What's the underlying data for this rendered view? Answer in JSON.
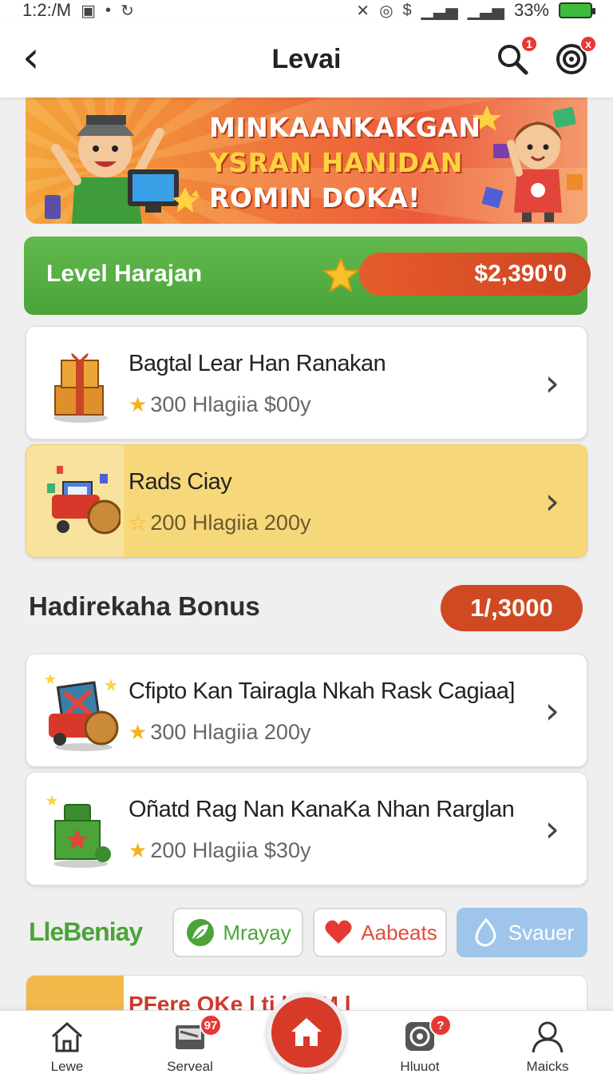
{
  "status_bar": {
    "time": "1:2:/M",
    "battery": "33%",
    "money_glyph": "$"
  },
  "header": {
    "title": "Levai",
    "search_badge": "1",
    "target_badge": "x"
  },
  "promo": {
    "lines": [
      "MINKAANKAKGAN",
      "YSRAN HANIDAN",
      "ROMIN DOKA!"
    ]
  },
  "level": {
    "label": "Level Harajan",
    "amount": "$2,390'0"
  },
  "cards": [
    {
      "title": "Bagtal Lear Han Ranakan",
      "meta": "300 Hlagiia $00y",
      "icon": "gift-box-icon"
    },
    {
      "title": "Rads Ciay",
      "meta": "200 Hlagiia 200y",
      "icon": "gift-cart-icon"
    },
    {
      "title": "Cfipto Kan Tairagla  Nkah Rask Cagiaa]",
      "meta": "300 Hlagiia 200y",
      "icon": "treasure-cart-icon"
    },
    {
      "title": "Oñatd Rag Nan KanaKa Nhan Rarglan",
      "meta": "200 Hlagiia $30y",
      "icon": "green-gift-icon"
    }
  ],
  "section": {
    "title": "Hadirekaha Bonus",
    "pill": "1/,3000"
  },
  "chips": {
    "title": "LleBeniay",
    "items": [
      {
        "label": "Mrayay",
        "icon": "leaf-icon",
        "color": "#4aa43a"
      },
      {
        "label": "Aabeats",
        "icon": "heart-icon",
        "color": "#e24c3c"
      },
      {
        "label": "Svauer",
        "icon": "drop-icon",
        "color": "#9fc6ea"
      }
    ]
  },
  "peek": {
    "text": "PFere OKe  l  ti     k  h    M     l"
  },
  "bottom_nav": {
    "items": [
      {
        "label": "Lewe",
        "icon": "home-outline-icon"
      },
      {
        "label": "Serveal",
        "icon": "inbox-icon",
        "badge": "97"
      },
      {
        "label": "",
        "icon": "home-icon"
      },
      {
        "label": "Hluuot",
        "icon": "target-icon",
        "badge": "?"
      },
      {
        "label": "Maicks",
        "icon": "profile-icon"
      }
    ]
  },
  "colors": {
    "green": "#4aa43a",
    "orange_red": "#cf4a22",
    "gold": "#f6d77a",
    "red": "#d83a2a"
  }
}
